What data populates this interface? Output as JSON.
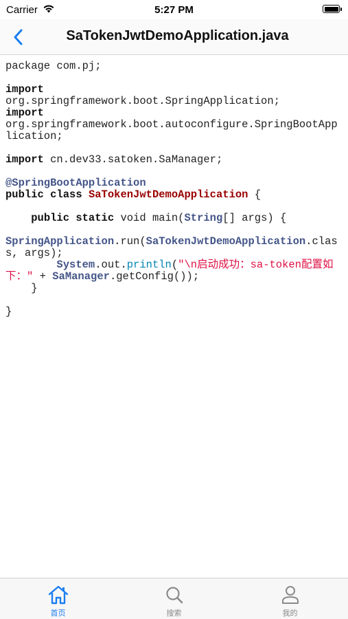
{
  "status_bar": {
    "carrier": "Carrier",
    "time": "5:27 PM"
  },
  "nav": {
    "title": "SaTokenJwtDemoApplication.java"
  },
  "code": {
    "package_kw": "package",
    "package_name": " com.pj;",
    "import_kw": "import",
    "import_1": "org.springframework.boot.SpringApplication;",
    "import_2": "org.springframework.boot.autoconfigure.SpringBootApplication;",
    "import_3": " cn.dev33.satoken.SaManager;",
    "annotation": "@SpringBootApplication",
    "class_mods": "public class",
    "class_name": "SaTokenJwtDemoApplication",
    "brace_open": " {",
    "method_mods": "public static",
    "method_sig": " void main(",
    "string_type": "String",
    "args_param": "[] args) {",
    "spring_app": "SpringApplication",
    "run_call": ".run(",
    "demo_class": "SaTokenJwtDemoApplication",
    "class_args": ".class, args);",
    "system": "System",
    "out": ".out.",
    "println": "println",
    "open_paren": "(",
    "message": "\"\\n启动成功：sa-token配置如下：\"",
    "plus": " + ",
    "samanager": "SaManager",
    "get_config": ".getConfig());",
    "close_method": "}",
    "close_class": "}"
  },
  "tabs": [
    {
      "label": "首页",
      "icon": "home-icon",
      "active": true
    },
    {
      "label": "搜索",
      "icon": "search-icon",
      "active": false
    },
    {
      "label": "我的",
      "icon": "person-icon",
      "active": false
    }
  ],
  "colors": {
    "accent": "#1a7ef0",
    "keyword": "#111111",
    "type": "#445588",
    "class_name": "#990000",
    "string": "#dd1144",
    "function": "#0086b3"
  }
}
